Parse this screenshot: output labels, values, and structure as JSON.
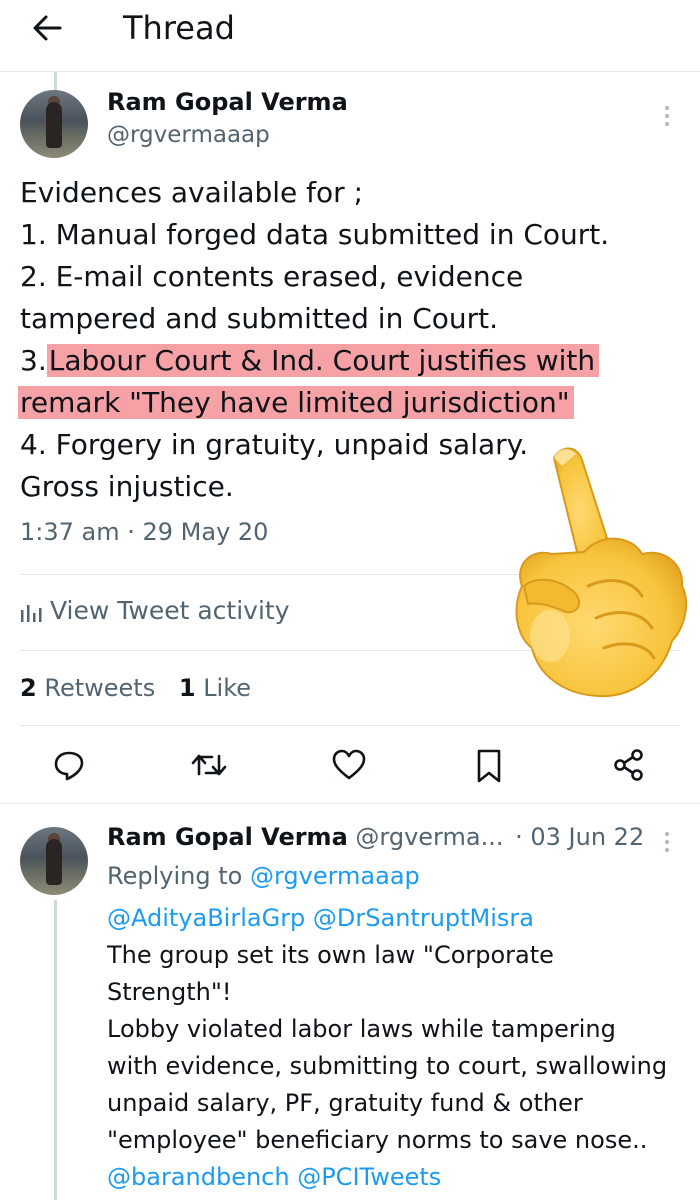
{
  "header": {
    "back_icon": "arrow-left-icon",
    "title": "Thread"
  },
  "tweet": {
    "author_name": "Ram Gopal Verma",
    "author_handle": "@rgvermaaap",
    "lines": [
      "Evidences available for ;",
      "1. Manual forged data submitted in Court.",
      "2. E-mail contents erased, evidence",
      "tampered and submitted in Court.",
      "3.",
      "Labour Court & Ind. Court justifies with",
      "remark \"They have limited jurisdiction\"",
      "4. Forgery in gratuity, unpaid salary.",
      "Gross injustice."
    ],
    "highlight_color": "#f6a1a6",
    "timestamp": "1:37 am · 29 May 20",
    "activity_label": "View Tweet activity",
    "retweet_count": "2",
    "retweet_label": "Retweets",
    "like_count": "1",
    "like_label": "Like",
    "action_icons": [
      "reply-icon",
      "retweet-icon",
      "like-icon",
      "bookmark-icon",
      "share-icon"
    ]
  },
  "overlay": {
    "emoji": "pointing-up-hand-emoji"
  },
  "reply": {
    "author_name": "Ram Gopal Verma",
    "author_handle": "@rgverma...",
    "date": "· 03 Jun 22",
    "replying_prefix": "Replying to",
    "replying_handle": "@rgvermaaap",
    "mentions_1": "@AdityaBirlaGrp @DrSantruptMisra",
    "lines": [
      "The group set its own law \"Corporate",
      "Strength\"!",
      "Lobby violated labor laws while tampering",
      "with evidence, submitting to court, swallowing",
      "unpaid salary, PF, gratuity fund & other",
      "\"employee\" beneficiary norms to save nose.."
    ],
    "mentions_2": "@barandbench @PCITweets"
  },
  "colors": {
    "link": "#1d9bf0",
    "secondary_text": "#536471",
    "primary_text": "#0f1419"
  }
}
